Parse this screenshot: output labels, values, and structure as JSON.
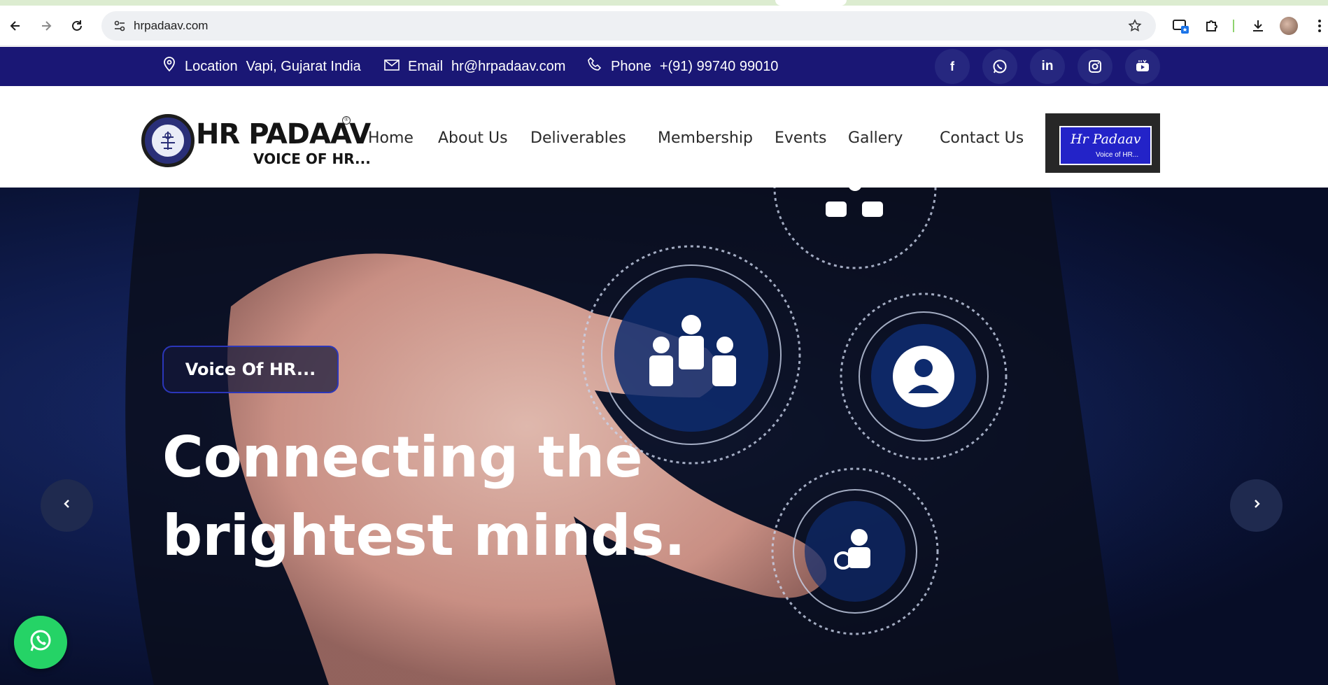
{
  "browser": {
    "url": "hrpadaav.com"
  },
  "topbar": {
    "location_label": "Location",
    "location_value": "Vapi, Gujarat India",
    "email_label": "Email",
    "email_value": "hr@hrpadaav.com",
    "phone_label": "Phone",
    "phone_value": "+(91) 99740 99010",
    "social": [
      "facebook-icon",
      "whatsapp-icon",
      "linkedin-icon",
      "instagram-icon",
      "youtube-icon"
    ]
  },
  "logo": {
    "brand": "HR PADAAV",
    "tagline": "VOICE OF HR..."
  },
  "nav": {
    "items": [
      "Home",
      "About Us",
      "Deliverables",
      "Membership",
      "Events",
      "Gallery",
      "Contact Us"
    ]
  },
  "badge": {
    "title": "Hr Padaav",
    "subtitle": "Voice of HR..."
  },
  "hero": {
    "eyebrow": "Voice Of HR...",
    "headline_line1": "Connecting the",
    "headline_line2": "brightest minds."
  },
  "colors": {
    "infobar": "#1a1775",
    "accent": "#2b36b9",
    "whatsapp": "#25d366"
  }
}
